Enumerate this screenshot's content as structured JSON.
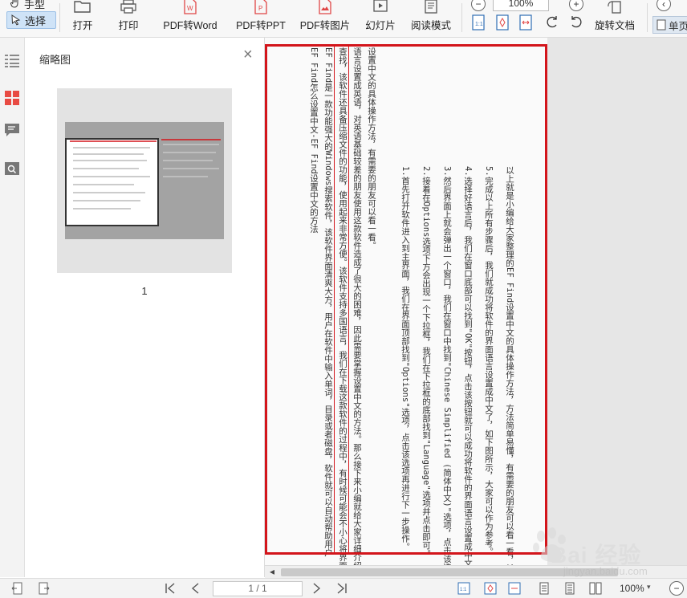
{
  "mode_switch": {
    "hand_label": "手型",
    "select_label": "选择"
  },
  "toolbar": {
    "open_label": "打开",
    "print_label": "打印",
    "pdf_to_word_label": "PDF转Word",
    "pdf_to_ppt_label": "PDF转PPT",
    "pdf_to_image_label": "PDF转图片",
    "slideshow_label": "幻灯片",
    "reading_mode_label": "阅读模式",
    "zoom_value": "100%",
    "rotate_doc_label": "旋转文档",
    "single_page_label": "单页"
  },
  "thumbnail_panel": {
    "title": "缩略图",
    "page_number": "1"
  },
  "document": {
    "lines": [
      "EF Find怎么设置中文-EF Find设置中文的方法",
      "EF Find是一款功能强大的Windows搜索软件，该软件界面清爽大方，用户在软件中输入单词，目录或者磁盘，软件就可以自动帮助用户",
      "查找，该软件还具备压缩文件的功能，使用起来非常方便。该软件支持多国语言，我们在下载这款软件的过程中，有时候可能会不小心将界面",
      "语言设置成英语，对英语基础较差的朋友使用这款软件造成了很大的困难，因此需要掌握设置中文的方法。那么接下来小编就给大家详细介绍一下EF Find",
      "设置中文的具体操作方法，有需要的朋友可以看一看。",
      "1.首先打开软件进入到主界面，我们在界面顶部找到\"Options\"选项，点击该选项再进行下一步操作。",
      "2.接着在Options选项下方会出现一个下拉框，我们在下拉框的底部找到\"Language\"选项并点击即可。",
      "3.然后界面上就会弹出一个窗口，我们在窗口中找到\"Chinese Simplified (简体中文)\"选项，点击该选项。",
      "4.选择好语言后，我们在窗口底部可以找到\"OK\"按钮，点击该按钮就可以成功将软件的界面语言设置成中文了。",
      "5.完成以上所有步骤后，我们就成功将软件的界面语言设置成中文了，如下图所示，大家可以作为参考。",
      "以上就是小编给大家整理的EF Find设置中文的具体操作方法，方法简单易懂，有需要的朋友可以看一看，希望这篇教程对大家有所帮助。"
    ]
  },
  "statusbar": {
    "page_indicator": "1 / 1",
    "zoom": "100%"
  },
  "watermark": {
    "brand": "Bai 经验",
    "url": "jingyan.baidu.com"
  },
  "colors": {
    "highlight_red": "#d3151b",
    "active_mode_bg": "#cfe3f7",
    "thumb_gray": "#a3a3a3"
  }
}
